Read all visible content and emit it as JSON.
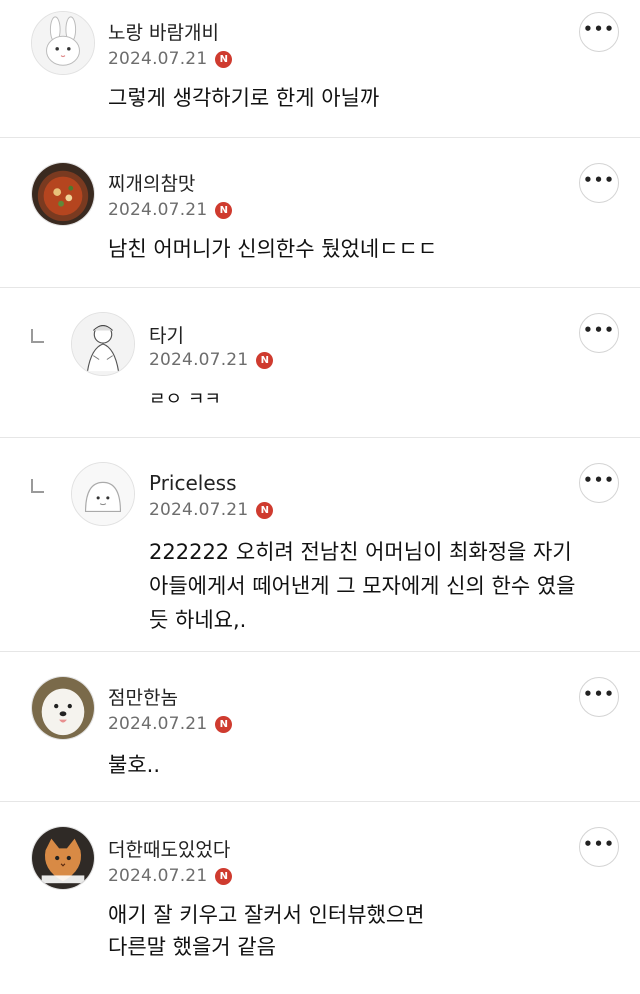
{
  "comments": [
    {
      "author": "노랑 바람개비",
      "date": "2024.07.21",
      "badge": "N",
      "text": "그렇게 생각하기로 한게 아닐까",
      "avatar_icon": "bunny-avatar-icon",
      "is_reply": false
    },
    {
      "author": "찌개의참맛",
      "date": "2024.07.21",
      "badge": "N",
      "text": "남친 어머니가 신의한수 뒀었네ㄷㄷㄷ",
      "avatar_icon": "stew-avatar-icon",
      "is_reply": false
    },
    {
      "author": "타기",
      "date": "2024.07.21",
      "badge": "N",
      "text": "ㄹㅇ ㅋㅋ",
      "avatar_icon": "sketch-person-avatar-icon",
      "is_reply": true
    },
    {
      "author": "Priceless",
      "date": "2024.07.21",
      "badge": "N",
      "text": "222222 오히려 전남친 어머님이 최화정을 자기\n아들에게서 떼어낸게 그 모자에게 신의 한수 였을\n듯 하네요,.",
      "avatar_icon": "blob-avatar-icon",
      "is_reply": true
    },
    {
      "author": "점만한놈",
      "date": "2024.07.21",
      "badge": "N",
      "text": "불호..",
      "avatar_icon": "dog-avatar-icon",
      "is_reply": false
    },
    {
      "author": "더한때도있었다",
      "date": "2024.07.21",
      "badge": "N",
      "text": "애기 잘 키우고 잘커서 인터뷰했으면\n다른말 했을거 같음",
      "avatar_icon": "cat-avatar-icon",
      "is_reply": false
    }
  ],
  "more_button_label": "•••",
  "reply_icon": "reply-arrow-icon",
  "colors": {
    "badge": "#cf3b2f",
    "date": "#6d6d6d",
    "divider": "#e6e6e6"
  }
}
